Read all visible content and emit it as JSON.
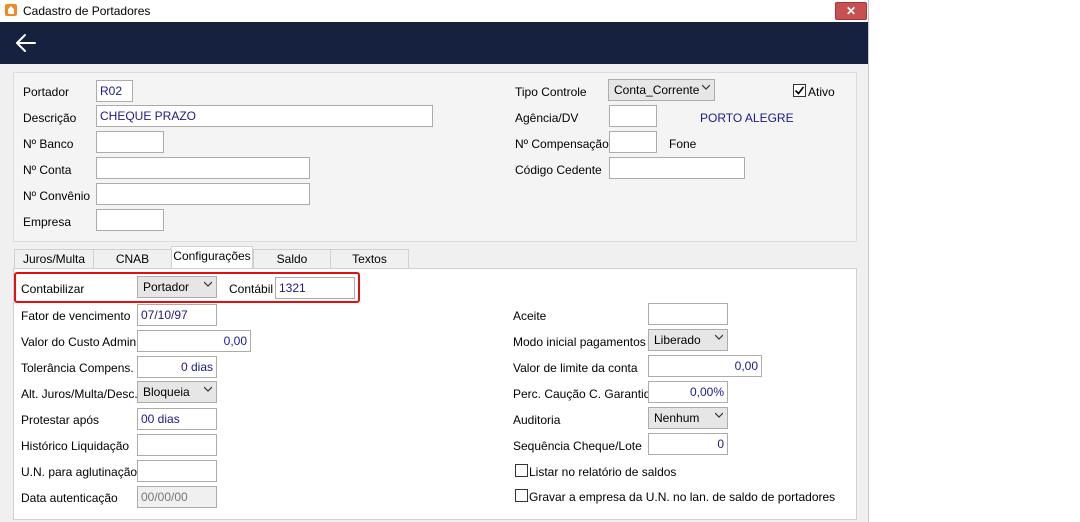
{
  "window": {
    "title": "Cadastro de Portadores",
    "close_glyph": "✕"
  },
  "header": {
    "portador_label": "Portador",
    "portador_value": "R02",
    "descricao_label": "Descrição",
    "descricao_value": "CHEQUE PRAZO",
    "nbanco_label": "Nº Banco",
    "nbanco_value": "",
    "nconta_label": "Nº Conta",
    "nconta_value": "",
    "nconvenio_label": "Nº Convênio",
    "nconvenio_value": "",
    "empresa_label": "Empresa",
    "empresa_value": "",
    "tipo_controle_label": "Tipo Controle",
    "tipo_controle_value": "Conta_Corrente",
    "ativo_label": "Ativo",
    "ativo_checked": true,
    "agencia_label": "Agência/DV",
    "agencia_value": "",
    "cidade": "PORTO ALEGRE",
    "ncompensacao_label": "Nº Compensação",
    "ncompensacao_value": "",
    "fone_label": "Fone",
    "codigo_cedente_label": "Código Cedente",
    "codigo_cedente_value": ""
  },
  "tabs": [
    {
      "label": "Juros/Multa"
    },
    {
      "label": "CNAB"
    },
    {
      "label": "Configurações",
      "active": true
    },
    {
      "label": "Saldo"
    },
    {
      "label": "Textos"
    }
  ],
  "config": {
    "contabilizar_label": "Contabilizar",
    "contabilizar_value": "Portador",
    "contabil_label": "Contábil",
    "contabil_value": "1321",
    "fator_label": "Fator de vencimento",
    "fator_value": "07/10/97",
    "custo_label": "Valor do Custo Admin.",
    "custo_value": "0,00",
    "tolerancia_label": "Tolerância Compens.",
    "tolerancia_value": "0 dias",
    "alt_label": "Alt. Juros/Multa/Desc.",
    "alt_value": "Bloqueia",
    "protestar_label": "Protestar após",
    "protestar_value": "00 dias",
    "historico_label": "Histórico Liquidação",
    "historico_value": "",
    "un_label": "U.N. para aglutinação",
    "un_value": "",
    "data_label": "Data autenticação",
    "data_value": "00/00/00",
    "aceite_label": "Aceite",
    "aceite_value": "",
    "modo_label": "Modo inicial pagamentos",
    "modo_value": "Liberado",
    "limite_label": "Valor de limite da conta",
    "limite_value": "0,00",
    "caucao_label": "Perc. Caução C. Garantida",
    "caucao_value": "0,00%",
    "auditoria_label": "Auditoria",
    "auditoria_value": "Nenhum",
    "sequencia_label": "Sequência Cheque/Lote",
    "sequencia_value": "0",
    "listar_label": "Listar no relatório de saldos",
    "listar_checked": false,
    "gravar_label": "Gravar a empresa da U.N. no lan. de saldo de portadores",
    "gravar_checked": false
  },
  "colors": {
    "navbar": "#16213f",
    "highlight": "#e01010",
    "value_text": "#1a1a8a"
  }
}
